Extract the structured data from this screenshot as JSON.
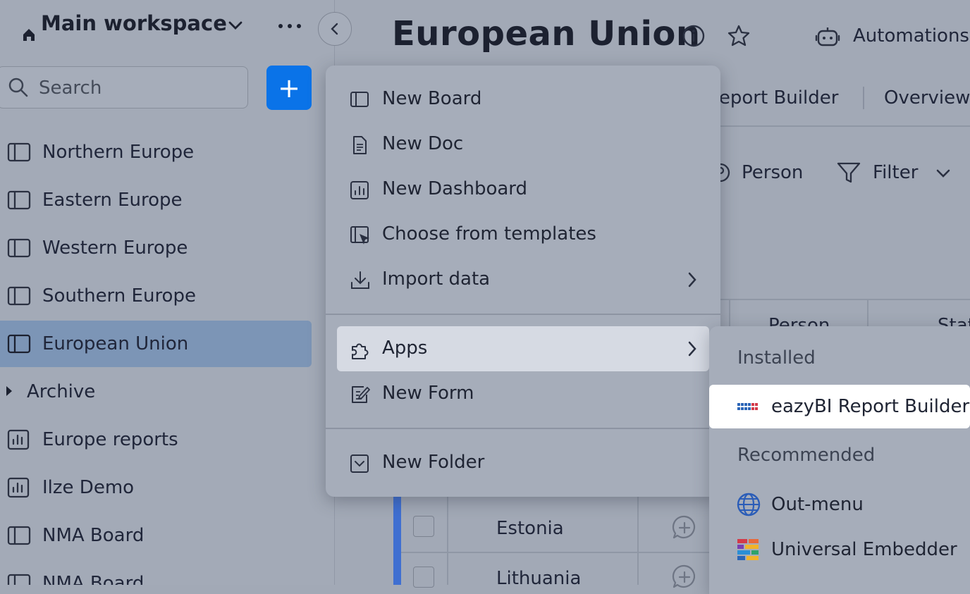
{
  "workspace": {
    "title": "Main workspace"
  },
  "sidebar": {
    "search_placeholder": "Search",
    "add_label": "+",
    "items": [
      {
        "label": "Northern Europe",
        "icon": "board-icon"
      },
      {
        "label": "Eastern Europe",
        "icon": "board-icon"
      },
      {
        "label": "Western Europe",
        "icon": "board-icon"
      },
      {
        "label": "Southern Europe",
        "icon": "board-icon"
      },
      {
        "label": "European Union",
        "icon": "board-icon",
        "active": true
      },
      {
        "label": "Archive",
        "icon": "caret-right-icon"
      },
      {
        "label": "Europe reports",
        "icon": "dashboard-icon"
      },
      {
        "label": "Ilze Demo",
        "icon": "dashboard-icon"
      },
      {
        "label": "NMA Board",
        "icon": "board-icon"
      },
      {
        "label": "NMA Board",
        "icon": "board-icon"
      }
    ]
  },
  "header": {
    "title": "European Union",
    "automations_label": "Automations",
    "tabs": [
      "Report Builder",
      "Overview"
    ],
    "toolbar": {
      "person": "Person",
      "filter": "Filter"
    },
    "table_headers": [
      "Person",
      "Stat"
    ]
  },
  "table": {
    "rows": [
      {
        "country": "Estonia"
      },
      {
        "country": "Lithuania"
      }
    ]
  },
  "menu": {
    "items": [
      {
        "label": "New Board",
        "icon": "board-icon"
      },
      {
        "label": "New Doc",
        "icon": "doc-icon"
      },
      {
        "label": "New Dashboard",
        "icon": "dashboard-icon"
      },
      {
        "label": "Choose from templates",
        "icon": "templates-icon"
      },
      {
        "label": "Import data",
        "icon": "download-icon"
      },
      {
        "label": "Apps",
        "icon": "puzzle-icon"
      },
      {
        "label": "New Form",
        "icon": "form-icon"
      },
      {
        "label": "New Folder",
        "icon": "folder-icon"
      }
    ]
  },
  "apps_submenu": {
    "installed_heading": "Installed",
    "installed": [
      {
        "label": "eazyBI Report Builder",
        "icon": "eazybi-logo-icon"
      }
    ],
    "recommended_heading": "Recommended",
    "recommended": [
      {
        "label": "Out-menu",
        "icon": "globe-icon"
      },
      {
        "label": "Universal Embedder",
        "icon": "embedder-icon"
      }
    ]
  },
  "colors": {
    "accent": "#0a73e8",
    "active_item": "#7c95b6",
    "group_bar": "#3f6fd1"
  }
}
